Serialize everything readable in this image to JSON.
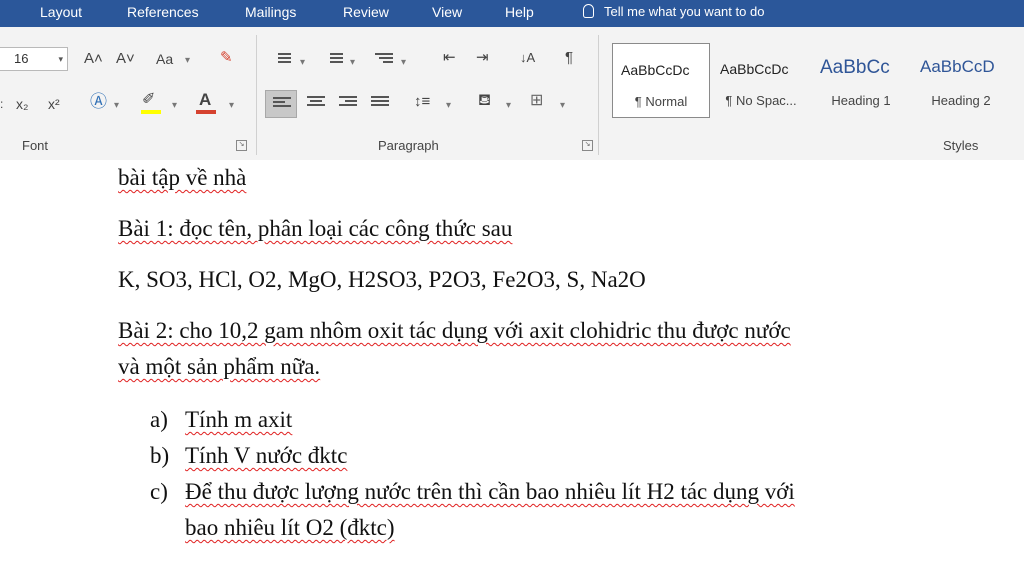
{
  "menu": {
    "tabs": [
      "Layout",
      "References",
      "Mailings",
      "Review",
      "View",
      "Help"
    ],
    "tell_me": "Tell me what you want to do"
  },
  "ribbon": {
    "font_size": "16",
    "groups": {
      "font": "Font",
      "paragraph": "Paragraph",
      "styles": "Styles"
    },
    "font_buttons": {
      "grow": "A˄",
      "shrink": "A˅",
      "change_case": "Aa",
      "subscript": "x₂",
      "superscript": "x²"
    },
    "styles": [
      {
        "preview": "AaBbCcDc",
        "name": "¶ Normal"
      },
      {
        "preview": "AaBbCcDc",
        "name": "¶ No Spac..."
      },
      {
        "preview": "AaBbCc",
        "name": "Heading 1"
      },
      {
        "preview": "AaBbCcD",
        "name": "Heading 2"
      }
    ]
  },
  "document": {
    "line1": "bài tập về nhà",
    "bai1_title": "Bài 1: đọc tên, phân loại các công thức sau",
    "formulas": "K, SO3, HCl, O2, MgO, H2SO3, P2O3, Fe2O3, S, Na2O",
    "bai2_line1": "Bài 2: cho 10,2 gam nhôm oxit tác dụng với axit clohidric thu được nước",
    "bai2_line2": "và một sản phẩm nữa.",
    "list": [
      {
        "marker": "a)",
        "text": "Tính m axit"
      },
      {
        "marker": "b)",
        "text": "Tính V nước đktc"
      },
      {
        "marker": "c)",
        "text": "Để thu được lượng nước trên thì cần bao nhiêu lít H2 tác dụng với",
        "cont": "bao nhiêu lít O2 (đktc)"
      }
    ]
  },
  "colors": {
    "title_bar": "#2b579a",
    "ribbon_bg": "#f3f3f3",
    "highlight": "#ffff00",
    "font_color": "#d5422f",
    "heading_blue": "#2f5597"
  }
}
